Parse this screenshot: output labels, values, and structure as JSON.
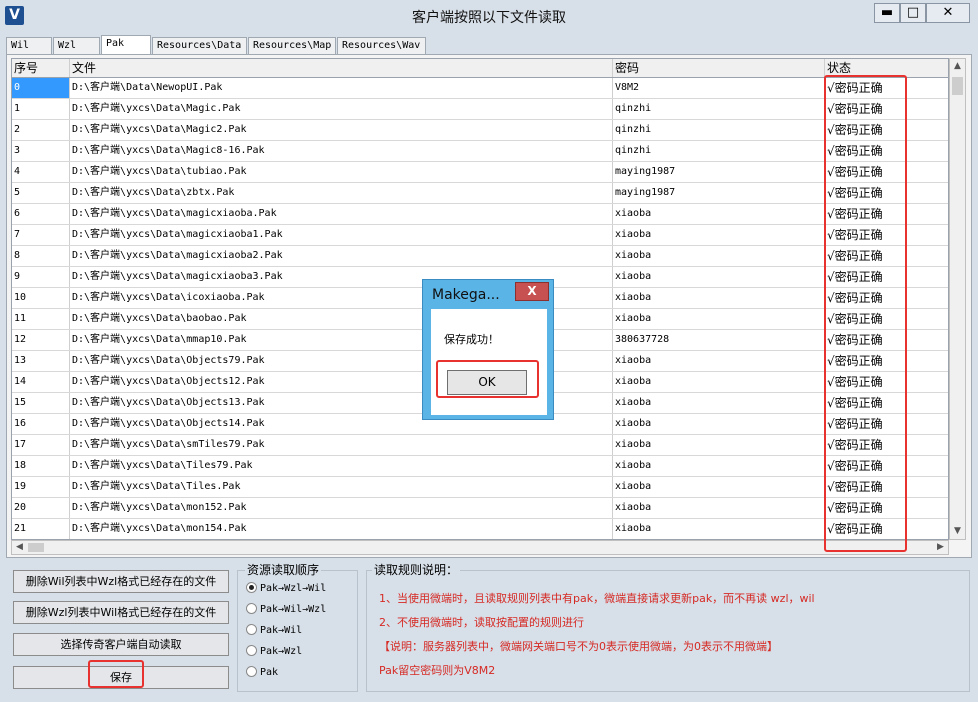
{
  "window": {
    "title": "客户端按照以下文件读取",
    "icon_label": "V",
    "minimize": "▬",
    "maximize": "□",
    "close": "✕"
  },
  "tabs": [
    {
      "label": "Wil"
    },
    {
      "label": "Wzl"
    },
    {
      "label": "Pak"
    },
    {
      "label": "Resources\\Data"
    },
    {
      "label": "Resources\\Map"
    },
    {
      "label": "Resources\\Wav"
    }
  ],
  "active_tab": "Pak",
  "table": {
    "headers": [
      "序号",
      "文件",
      "密码",
      "状态"
    ],
    "rows": [
      {
        "no": "0",
        "file": "D:\\客户端\\Data\\NewopUI.Pak",
        "pwd": "V8M2",
        "status": "√密码正确"
      },
      {
        "no": "1",
        "file": "D:\\客户端\\yxcs\\Data\\Magic.Pak",
        "pwd": "qinzhi",
        "status": "√密码正确"
      },
      {
        "no": "2",
        "file": "D:\\客户端\\yxcs\\Data\\Magic2.Pak",
        "pwd": "qinzhi",
        "status": "√密码正确"
      },
      {
        "no": "3",
        "file": "D:\\客户端\\yxcs\\Data\\Magic8-16.Pak",
        "pwd": "qinzhi",
        "status": "√密码正确"
      },
      {
        "no": "4",
        "file": "D:\\客户端\\yxcs\\Data\\tubiao.Pak",
        "pwd": "maying1987",
        "status": "√密码正确"
      },
      {
        "no": "5",
        "file": "D:\\客户端\\yxcs\\Data\\zbtx.Pak",
        "pwd": "maying1987",
        "status": "√密码正确"
      },
      {
        "no": "6",
        "file": "D:\\客户端\\yxcs\\Data\\magicxiaoba.Pak",
        "pwd": "xiaoba",
        "status": "√密码正确"
      },
      {
        "no": "7",
        "file": "D:\\客户端\\yxcs\\Data\\magicxiaoba1.Pak",
        "pwd": "xiaoba",
        "status": "√密码正确"
      },
      {
        "no": "8",
        "file": "D:\\客户端\\yxcs\\Data\\magicxiaoba2.Pak",
        "pwd": "xiaoba",
        "status": "√密码正确"
      },
      {
        "no": "9",
        "file": "D:\\客户端\\yxcs\\Data\\magicxiaoba3.Pak",
        "pwd": "xiaoba",
        "status": "√密码正确"
      },
      {
        "no": "10",
        "file": "D:\\客户端\\yxcs\\Data\\icoxiaoba.Pak",
        "pwd": "xiaoba",
        "status": "√密码正确"
      },
      {
        "no": "11",
        "file": "D:\\客户端\\yxcs\\Data\\baobao.Pak",
        "pwd": "xiaoba",
        "status": "√密码正确"
      },
      {
        "no": "12",
        "file": "D:\\客户端\\yxcs\\Data\\mmap10.Pak",
        "pwd": "380637728",
        "status": "√密码正确"
      },
      {
        "no": "13",
        "file": "D:\\客户端\\yxcs\\Data\\Objects79.Pak",
        "pwd": "xiaoba",
        "status": "√密码正确"
      },
      {
        "no": "14",
        "file": "D:\\客户端\\yxcs\\Data\\Objects12.Pak",
        "pwd": "xiaoba",
        "status": "√密码正确"
      },
      {
        "no": "15",
        "file": "D:\\客户端\\yxcs\\Data\\Objects13.Pak",
        "pwd": "xiaoba",
        "status": "√密码正确"
      },
      {
        "no": "16",
        "file": "D:\\客户端\\yxcs\\Data\\Objects14.Pak",
        "pwd": "xiaoba",
        "status": "√密码正确"
      },
      {
        "no": "17",
        "file": "D:\\客户端\\yxcs\\Data\\smTiles79.Pak",
        "pwd": "xiaoba",
        "status": "√密码正确"
      },
      {
        "no": "18",
        "file": "D:\\客户端\\yxcs\\Data\\Tiles79.Pak",
        "pwd": "xiaoba",
        "status": "√密码正确"
      },
      {
        "no": "19",
        "file": "D:\\客户端\\yxcs\\Data\\Tiles.Pak",
        "pwd": "xiaoba",
        "status": "√密码正确"
      },
      {
        "no": "20",
        "file": "D:\\客户端\\yxcs\\Data\\mon152.Pak",
        "pwd": "xiaoba",
        "status": "√密码正确"
      },
      {
        "no": "21",
        "file": "D:\\客户端\\yxcs\\Data\\mon154.Pak",
        "pwd": "xiaoba",
        "status": "√密码正确"
      }
    ]
  },
  "dialog": {
    "title": "Makega...",
    "close": "X",
    "message": "保存成功！",
    "ok": "OK"
  },
  "buttons": {
    "delete_wil": "删除Wil列表中Wzl格式已经存在的文件",
    "delete_wzl": "删除Wzl列表中Wil格式已经存在的文件",
    "select_client": "选择传奇客户端自动读取",
    "save": "保存"
  },
  "order": {
    "title": "资源读取顺序",
    "options": [
      {
        "label": "Pak→Wzl→Wil",
        "checked": true
      },
      {
        "label": "Pak→Wil→Wzl",
        "checked": false
      },
      {
        "label": "Pak→Wil",
        "checked": false
      },
      {
        "label": "Pak→Wzl",
        "checked": false
      },
      {
        "label": "Pak",
        "checked": false
      }
    ]
  },
  "rules": {
    "title": "读取规则说明：",
    "lines": [
      "1、当使用微端时，且读取规则列表中有pak，微端直接请求更新pak，而不再读 wzl，wil",
      "2、不使用微端时，读取按配置的规则进行",
      "【说明：服务器列表中，微端网关端口号不为0表示使用微端，为0表示不用微端】",
      "Pak留空密码则为V8M2"
    ]
  },
  "colors": {
    "highlight": "#e8322f",
    "selection": "#3399ff",
    "dialog_frame": "#5ab4e6",
    "rule_text": "#d62a24"
  }
}
